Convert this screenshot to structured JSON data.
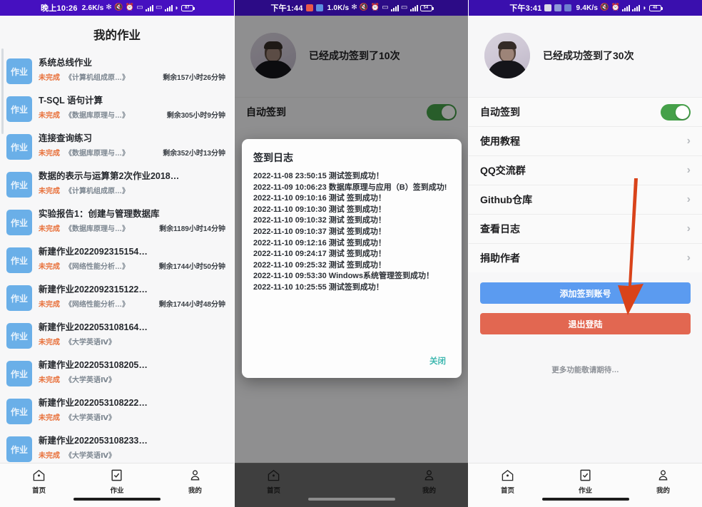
{
  "panel1": {
    "statusbar": {
      "time": "晚上10:26",
      "netspeed": "2.6K/s",
      "battery_level": "87",
      "icons": [
        "bluetooth-icon",
        "mute-icon",
        "alarm-icon",
        "hd-icon",
        "signal-4g-icon",
        "hd-icon",
        "signal-4g-icon",
        "wifi-icon",
        "battery-icon"
      ]
    },
    "title": "我的作业",
    "badge_label": "作业",
    "list": [
      {
        "name": "系统总线作业",
        "state": "未完成",
        "course": "《计算机组成原…》",
        "remaining": "剩余157小时26分钟"
      },
      {
        "name": "T-SQL 语句计算",
        "state": "未完成",
        "course": "《数据库原理与…》",
        "remaining": "剩余305小时9分钟"
      },
      {
        "name": "连接查询练习",
        "state": "未完成",
        "course": "《数据库原理与…》",
        "remaining": "剩余352小时13分钟"
      },
      {
        "name": "数据的表示与运算第2次作业2018…",
        "state": "未完成",
        "course": "《计算机组成原…》",
        "remaining": ""
      },
      {
        "name": "实验报告1：创建与管理数据库",
        "state": "未完成",
        "course": "《数据库原理与…》",
        "remaining": "剩余1189小时14分钟"
      },
      {
        "name": "新建作业2022092315154…",
        "state": "未完成",
        "course": "《网络性能分析…》",
        "remaining": "剩余1744小时50分钟"
      },
      {
        "name": "新建作业2022092315122…",
        "state": "未完成",
        "course": "《网络性能分析…》",
        "remaining": "剩余1744小时48分钟"
      },
      {
        "name": "新建作业2022053108164…",
        "state": "未完成",
        "course": "《大学英语Ⅳ》",
        "remaining": ""
      },
      {
        "name": "新建作业2022053108205…",
        "state": "未完成",
        "course": "《大学英语Ⅳ》",
        "remaining": ""
      },
      {
        "name": "新建作业2022053108222…",
        "state": "未完成",
        "course": "《大学英语Ⅳ》",
        "remaining": ""
      },
      {
        "name": "新建作业2022053108233…",
        "state": "未完成",
        "course": "《大学英语Ⅳ》",
        "remaining": ""
      }
    ],
    "nav": [
      {
        "label": "首页",
        "icon": "home-icon",
        "active": false
      },
      {
        "label": "作业",
        "icon": "checklist-icon",
        "active": true
      },
      {
        "label": "我的",
        "icon": "person-icon",
        "active": false
      }
    ]
  },
  "panel2": {
    "statusbar": {
      "time": "下午1:44",
      "netspeed": "1.0K/s",
      "battery_level": "54",
      "icons": [
        "bluetooth-icon",
        "mute-icon",
        "alarm-icon",
        "hd-icon",
        "signal-4g-icon",
        "hd-icon",
        "signal-4g-icon",
        "battery-icon"
      ]
    },
    "signin_count_text": "已经成功签到了10次",
    "auto_signin_label": "自动签到",
    "auto_signin_on": "on",
    "dialog": {
      "title": "签到日志",
      "lines": [
        "2022-11-08 23:50:15  测试签到成功！",
        "2022-11-09 10:06:23  数据库原理与应用（B）签到成功!",
        "2022-11-10 09:10:16  测试  签到成功！",
        "2022-11-10 09:10:30  测试  签到成功！",
        "2022-11-10 09:10:32  测试  签到成功！",
        "2022-11-10 09:10:37  测试  签到成功！",
        "2022-11-10 09:12:16  测试  签到成功！",
        "2022-11-10 09:24:17  测试  签到成功！",
        "2022-11-10 09:25:32  测试  签到成功！",
        "2022-11-10 09:53:30  Windows系统管理签到成功！",
        "2022-11-10 10:25:55  测试签到成功！"
      ],
      "close_label": "关闭"
    },
    "nav": [
      {
        "label": "首页",
        "icon": "home-icon",
        "active": false
      },
      {
        "label": "",
        "icon": "",
        "active": false
      },
      {
        "label": "我的",
        "icon": "person-icon",
        "active": false
      }
    ]
  },
  "panel3": {
    "statusbar": {
      "time": "下午3:41",
      "netspeed": "9.4K/s",
      "battery_level": "46",
      "icons": [
        "mute-icon",
        "alarm-icon",
        "signal-4g-icon",
        "signal-4g-icon",
        "wifi-icon",
        "battery-icon"
      ]
    },
    "signin_count_text": "已经成功签到了30次",
    "auto_signin_label": "自动签到",
    "auto_signin_on": "on",
    "menu": [
      {
        "label": "使用教程"
      },
      {
        "label": "QQ交流群"
      },
      {
        "label": "Github仓库"
      },
      {
        "label": "查看日志"
      },
      {
        "label": "捐助作者"
      }
    ],
    "add_account_label": "添加签到账号",
    "logout_label": "退出登陆",
    "more_note": "更多功能敬请期待…",
    "nav": [
      {
        "label": "首页",
        "icon": "home-icon",
        "active": false
      },
      {
        "label": "作业",
        "icon": "checklist-icon",
        "active": true
      },
      {
        "label": "我的",
        "icon": "person-icon",
        "active": false
      }
    ]
  },
  "colors": {
    "statusbar_purple": "#4610c0",
    "statusbar_purple_dark": "#2c0b86",
    "badge_blue": "#6aafe8",
    "state_orange": "#e8703a",
    "toggle_green": "#45a049",
    "primary_blue": "#5b9bf0",
    "danger_red": "#e26751",
    "close_teal": "#3fb8b0",
    "arrow_orange": "#d9431a"
  }
}
